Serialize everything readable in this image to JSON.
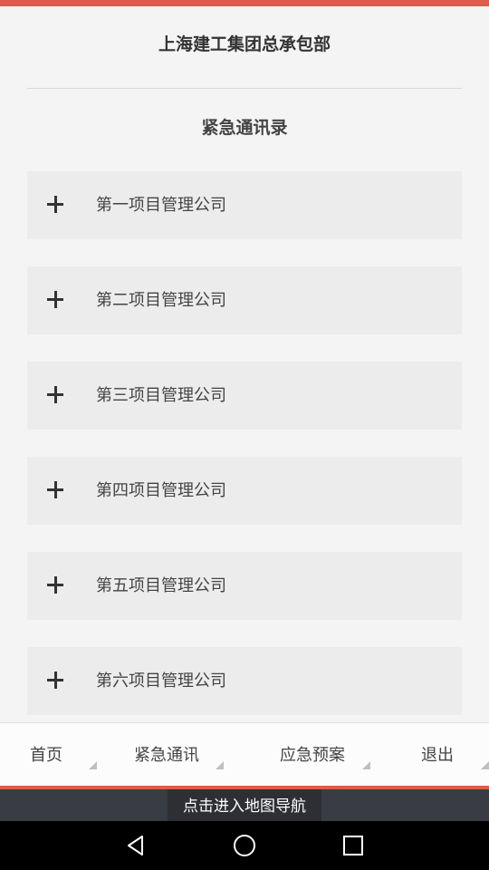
{
  "header": {
    "app_title": "上海建工集团总承包部",
    "page_title": "紧急通讯录"
  },
  "companies": [
    {
      "label": "第一项目管理公司",
      "icon": "plus-icon"
    },
    {
      "label": "第二项目管理公司",
      "icon": "plus-icon"
    },
    {
      "label": "第三项目管理公司",
      "icon": "plus-icon"
    },
    {
      "label": "第四项目管理公司",
      "icon": "plus-icon"
    },
    {
      "label": "第五项目管理公司",
      "icon": "plus-icon"
    },
    {
      "label": "第六项目管理公司",
      "icon": "plus-icon"
    }
  ],
  "bottom_nav": {
    "home": "首页",
    "contacts": "紧急通讯",
    "plans": "应急预案",
    "logout": "退出"
  },
  "map_nav": {
    "label": "点击进入地图导航"
  },
  "colors": {
    "accent": "#e05a50",
    "item_bg": "#ececec",
    "map_bar": "#3a3c44"
  }
}
